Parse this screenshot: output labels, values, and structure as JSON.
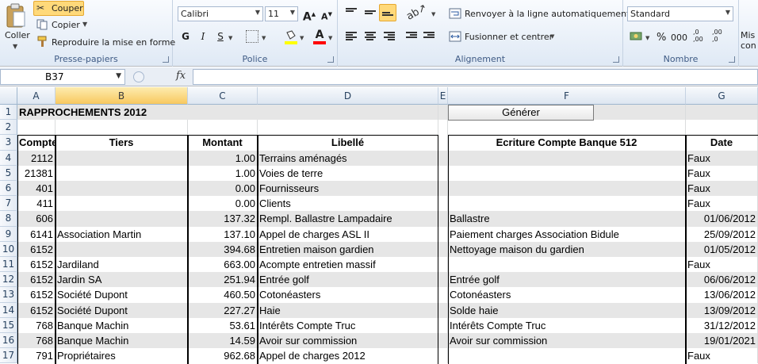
{
  "ribbon": {
    "clipboard": {
      "label": "Presse-papiers",
      "paste": "Coller",
      "cut": "Couper",
      "copy": "Copier",
      "format_painter": "Reproduire la mise en forme"
    },
    "font": {
      "label": "Police",
      "font_name": "Calibri",
      "font_size": "11",
      "bold": "G",
      "italic": "I",
      "underline": "S",
      "grow": "A",
      "shrink": "A",
      "font_color_glyph": "A"
    },
    "alignment": {
      "label": "Alignement",
      "wrap_text": "Renvoyer à la ligne automatiquement",
      "merge_center": "Fusionner et centrer"
    },
    "number": {
      "label": "Nombre",
      "format": "Standard",
      "percent": "%",
      "thousands": "000",
      "inc_decimal": ",00",
      "dec_decimal": ",0"
    },
    "styles": {
      "partial_top": "Mis",
      "partial_bottom": "con"
    }
  },
  "formula_bar": {
    "name_box": "B37",
    "fx": "fx",
    "content": ""
  },
  "columns": [
    "A",
    "B",
    "C",
    "D",
    "E",
    "F",
    "G"
  ],
  "selected_column": "B",
  "rows": [
    {
      "n": "1",
      "A": "RAPPROCHEMENTS 2012",
      "B": "",
      "C": "",
      "D": "",
      "F": "",
      "G": ""
    },
    {
      "n": "2",
      "A": "",
      "B": "",
      "C": "",
      "D": "",
      "F": "",
      "G": ""
    },
    {
      "n": "3",
      "A": "Compte",
      "B": "Tiers",
      "C": "Montant",
      "D": "Libellé",
      "F": "Ecriture Compte Banque 512",
      "G": "Date"
    },
    {
      "n": "4",
      "A": "2112",
      "B": "",
      "C": "1.00",
      "D": "Terrains aménagés",
      "F": "",
      "G": "Faux"
    },
    {
      "n": "5",
      "A": "21381",
      "B": "",
      "C": "1.00",
      "D": "Voies de terre",
      "F": "",
      "G": "Faux"
    },
    {
      "n": "6",
      "A": "401",
      "B": "",
      "C": "0.00",
      "D": "Fournisseurs",
      "F": "",
      "G": "Faux"
    },
    {
      "n": "7",
      "A": "411",
      "B": "",
      "C": "0.00",
      "D": "Clients",
      "F": "",
      "G": "Faux"
    },
    {
      "n": "8",
      "A": "606",
      "B": "",
      "C": "137.32",
      "D": "Rempl. Ballastre Lampadaire",
      "F": "Ballastre",
      "G": "01/06/2012"
    },
    {
      "n": "9",
      "A": "6141",
      "B": "Association Martin",
      "C": "137.10",
      "D": "Appel de charges ASL II",
      "F": "Paiement charges Association Bidule",
      "G": "25/09/2012"
    },
    {
      "n": "10",
      "A": "6152",
      "B": "",
      "C": "394.68",
      "D": "Entretien maison gardien",
      "F": "Nettoyage maison du gardien",
      "G": "01/05/2012"
    },
    {
      "n": "11",
      "A": "6152",
      "B": "Jardiland",
      "C": "663.00",
      "D": "Acompte entretien massif",
      "F": "",
      "G": "Faux"
    },
    {
      "n": "12",
      "A": "6152",
      "B": "Jardin SA",
      "C": "251.94",
      "D": "Entrée golf",
      "F": "Entrée golf",
      "G": "06/06/2012"
    },
    {
      "n": "13",
      "A": "6152",
      "B": "Société Dupont",
      "C": "460.50",
      "D": "Cotonéasters",
      "F": "Cotonéasters",
      "G": "13/06/2012"
    },
    {
      "n": "14",
      "A": "6152",
      "B": "Société Dupont",
      "C": "227.27",
      "D": "Haie",
      "F": "Solde haie",
      "G": "13/09/2012"
    },
    {
      "n": "15",
      "A": "768",
      "B": "Banque Machin",
      "C": "53.61",
      "D": "Intérêts Compte Truc",
      "F": "Intérêts Compte Truc",
      "G": "31/12/2012"
    },
    {
      "n": "16",
      "A": "768",
      "B": "Banque Machin",
      "C": "14.59",
      "D": "Avoir sur commission",
      "F": "Avoir sur commission",
      "G": "19/01/2021"
    },
    {
      "n": "17",
      "A": "791",
      "B": "Propriétaires",
      "C": "962.68",
      "D": "Appel de charges 2012",
      "F": "",
      "G": "Faux"
    }
  ],
  "generate_button": "Générer",
  "colors": {
    "ribbon_bg": "#dfe9f5",
    "stripe": "#e6e6e6",
    "selected_header": "#f8c85f",
    "highlight_button": "#ffd97a"
  }
}
